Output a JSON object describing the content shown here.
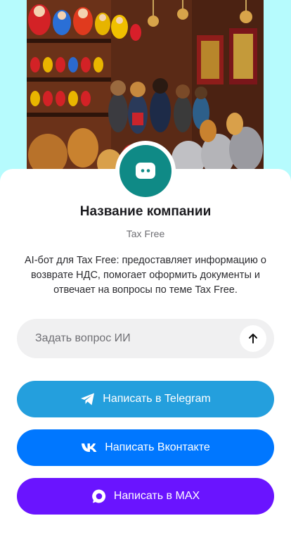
{
  "company": {
    "name": "Название компании",
    "tagline": "Tax Free",
    "description": "AI-бот для Tax Free: предоставляет информацию о возврате НДС, помогает оформить документы и отвечает на вопросы по теме Tax Free."
  },
  "ask": {
    "placeholder": "Задать вопрос ИИ",
    "send_icon": "arrow-up-icon"
  },
  "buttons": [
    {
      "label": "Написать в Telegram",
      "icon": "telegram-icon",
      "color": "#249fdd"
    },
    {
      "label": "Написать Вконтакте",
      "icon": "vk-icon",
      "color": "#0077ff"
    },
    {
      "label": "Написать в MAX",
      "icon": "max-icon",
      "color": "#6a14ff"
    }
  ],
  "colors": {
    "page_background": "#b6fbfd",
    "avatar": "#0f8a86"
  }
}
